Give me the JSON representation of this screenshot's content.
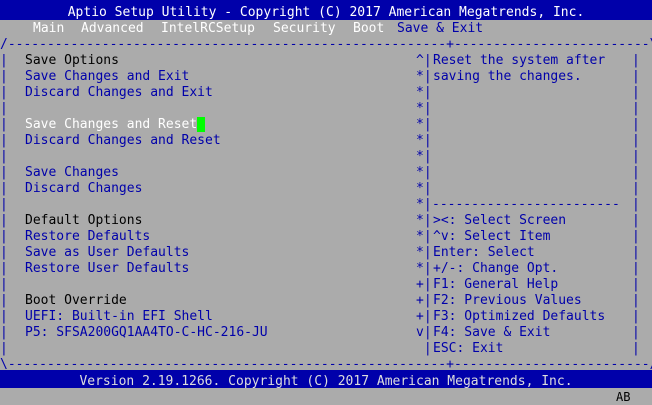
{
  "header": {
    "title": "Aptio Setup Utility - Copyright (C) 2017 American Megatrends, Inc.",
    "tabs": [
      "Main",
      "Advanced",
      "IntelRCSetup",
      "Security",
      "Boot",
      "Save & Exit"
    ],
    "active_tab": "Save & Exit"
  },
  "menu": {
    "section_save": "Save Options",
    "save_changes_and_exit": "Save Changes and Exit",
    "discard_changes_and_exit": "Discard Changes and Exit",
    "save_changes_and_reset": "Save Changes and Reset",
    "discard_changes_and_reset": "Discard Changes and Reset",
    "save_changes": "Save Changes",
    "discard_changes": "Discard Changes",
    "section_defaults": "Default Options",
    "restore_defaults": "Restore Defaults",
    "save_as_user_defaults": "Save as User Defaults",
    "restore_user_defaults": "Restore User Defaults",
    "section_boot_override": "Boot Override",
    "uefi_shell": "UEFI: Built-in EFI Shell",
    "p5_drive": "P5: SFSA200GQ1AA4TO-C-HC-216-JU"
  },
  "help": {
    "line1": "Reset the system after",
    "line2": "saving the changes."
  },
  "keys": [
    "><: Select Screen",
    "^v: Select Item",
    "Enter: Select",
    "+/-: Change Opt.",
    "F1: General Help",
    "F2: Previous Values",
    "F3: Optimized Defaults",
    "F4: Save & Exit",
    "ESC: Exit"
  ],
  "footer": {
    "version": "Version 2.19.1266. Copyright (C) 2017 American Megatrends, Inc.",
    "corner": "AB"
  },
  "colors": {
    "background": "#ababab",
    "bar": "#0000aa",
    "cursor": "#00ff00"
  }
}
